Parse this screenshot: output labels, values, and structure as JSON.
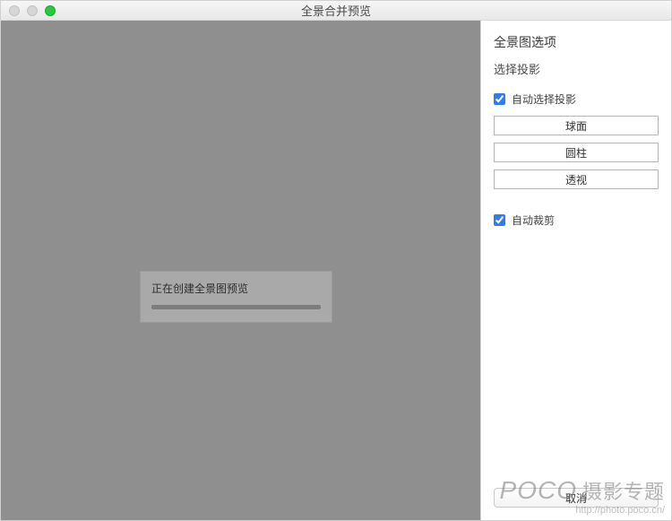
{
  "window": {
    "title": "全景合并预览"
  },
  "preview": {
    "progress_label": "正在创建全景图预览"
  },
  "panel": {
    "heading": "全景图选项",
    "sub": "选择投影",
    "auto_select_projection_label": "自动选择投影",
    "projection": {
      "spherical": "球面",
      "cylindrical": "圆柱",
      "perspective": "透视"
    },
    "auto_crop_label": "自动裁剪"
  },
  "actions": {
    "cancel": "取消"
  },
  "watermark": {
    "brand": "POCO",
    "cn": "摄影专题",
    "url": "http://photo.poco.cn/"
  }
}
